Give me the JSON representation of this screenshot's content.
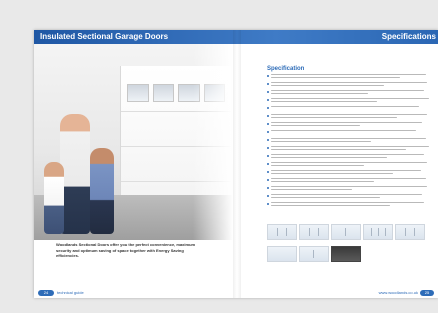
{
  "header": {
    "left_title": "Insulated Sectional Garage Doors",
    "right_title": "Specifications"
  },
  "specification": {
    "title": "Specification"
  },
  "caption": "Woodlands Sectional Doors offer you the perfect convenience, maximum security and optimum saving of space together with Energy Saving efficiencies.",
  "footer": {
    "left_page": "24",
    "left_text": "technical guide",
    "right_text": "www.woodlands.co.uk",
    "right_page": "25"
  },
  "colors": {
    "accent": "#2e6cb8",
    "header_blue": "#1f57a4"
  }
}
